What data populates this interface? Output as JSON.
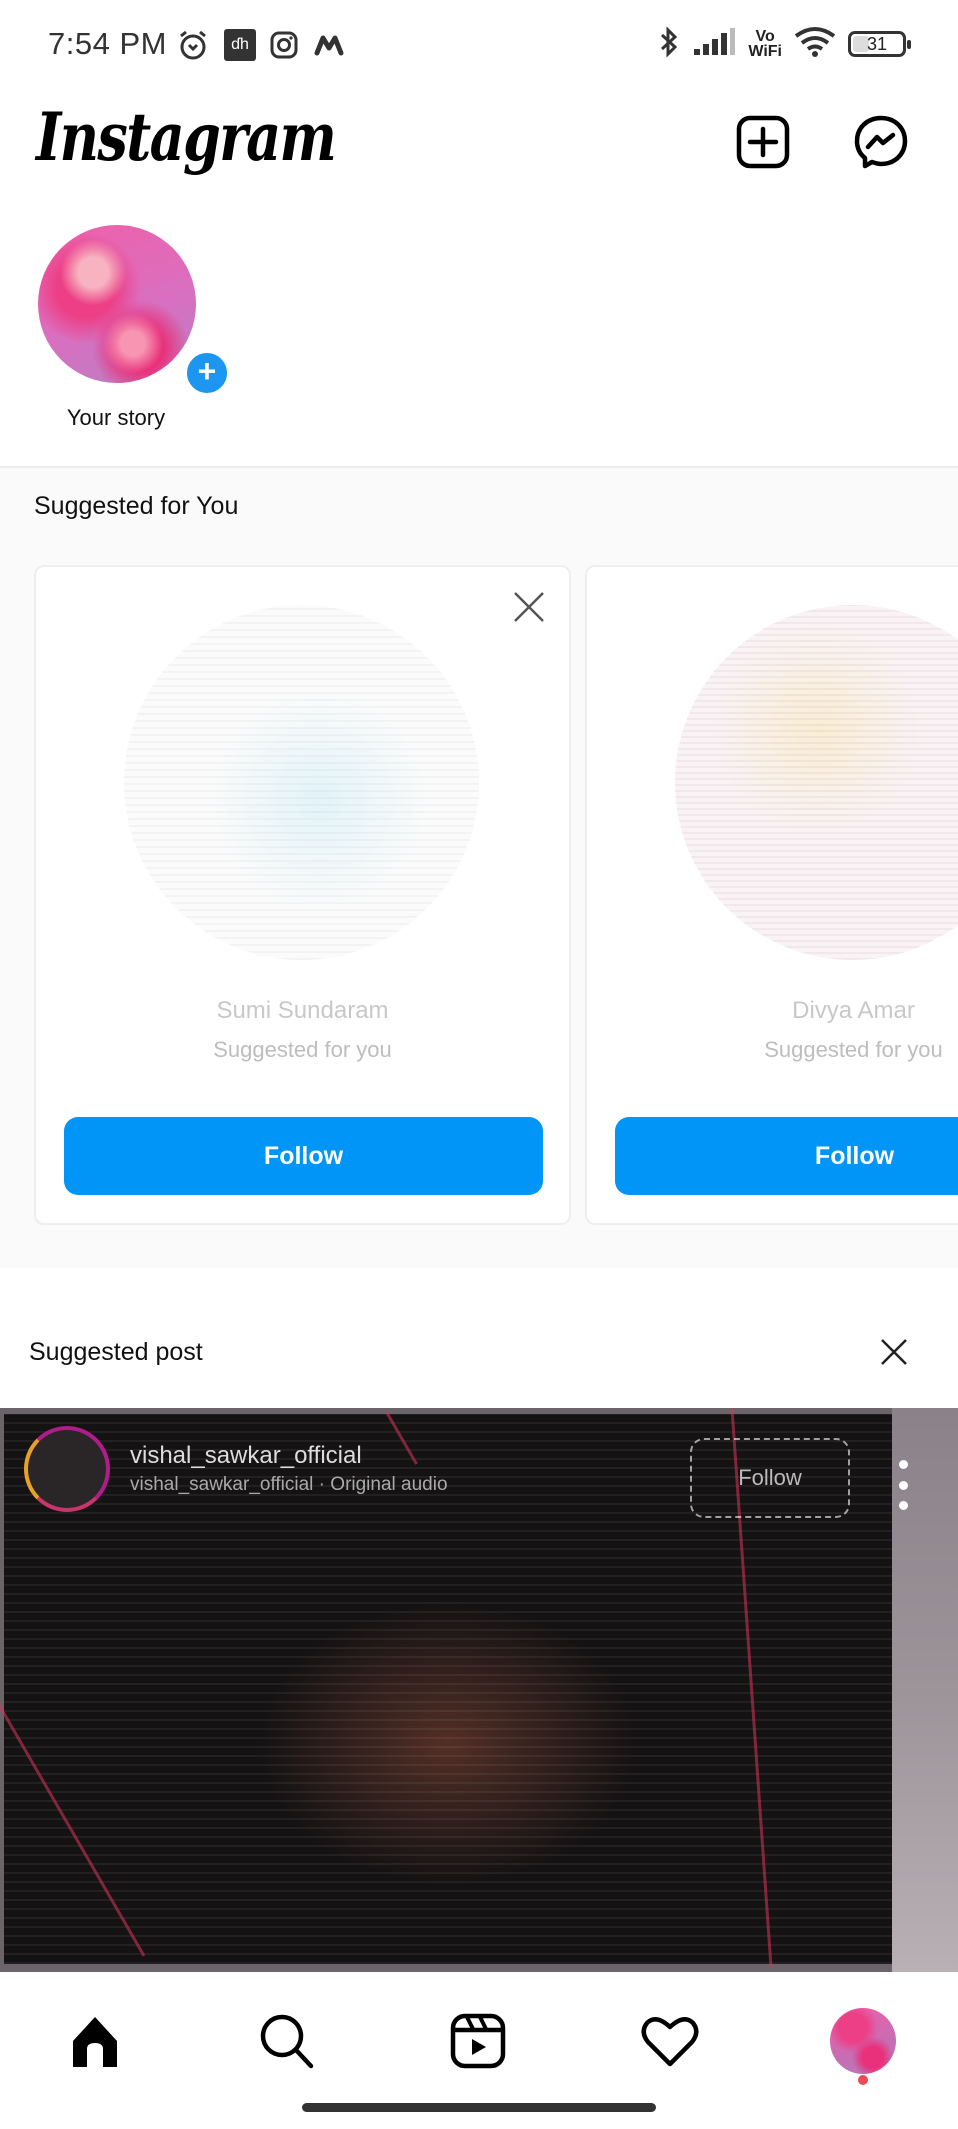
{
  "status_bar": {
    "time": "7:54 PM",
    "left_icons": [
      "alarm-icon",
      "disney-hotstar-icon",
      "instagram-icon",
      "myntra-icon"
    ],
    "right_icons": [
      "bluetooth-icon",
      "signal-icon",
      "vowifi-icon",
      "wifi-icon",
      "battery-icon"
    ],
    "vowifi_top": "Vo",
    "vowifi_bottom": "WiFi",
    "battery_level": "31",
    "hotstar_label": "ɗh"
  },
  "header": {
    "logo": "Instagram",
    "actions": [
      {
        "name": "new-post",
        "icon": "plus-square-icon"
      },
      {
        "name": "messenger",
        "icon": "messenger-icon"
      }
    ]
  },
  "stories": [
    {
      "label": "Your story",
      "add_icon": "+"
    }
  ],
  "suggested_for_you": {
    "title": "Suggested for You",
    "cards": [
      {
        "name": "Sumi Sundaram",
        "subtitle": "Suggested for you",
        "button": "Follow"
      },
      {
        "name": "Divya Amar",
        "subtitle": "Suggested for you",
        "button": "Follow"
      }
    ]
  },
  "suggested_post": {
    "title": "Suggested post",
    "username": "vishal_sawkar_official",
    "audio": "vishal_sawkar_official · Original audio",
    "follow_label": "Follow"
  },
  "bottom_nav": {
    "items": [
      {
        "name": "home",
        "icon": "home-icon",
        "active": true
      },
      {
        "name": "search",
        "icon": "search-icon"
      },
      {
        "name": "reels",
        "icon": "reels-icon"
      },
      {
        "name": "activity",
        "icon": "heart-icon"
      },
      {
        "name": "profile",
        "icon": "profile-avatar",
        "notification_dot": true
      }
    ]
  },
  "colors": {
    "primary_blue": "#0095f6",
    "story_add_blue": "#1d96f2",
    "notification_red": "#ed4956"
  }
}
